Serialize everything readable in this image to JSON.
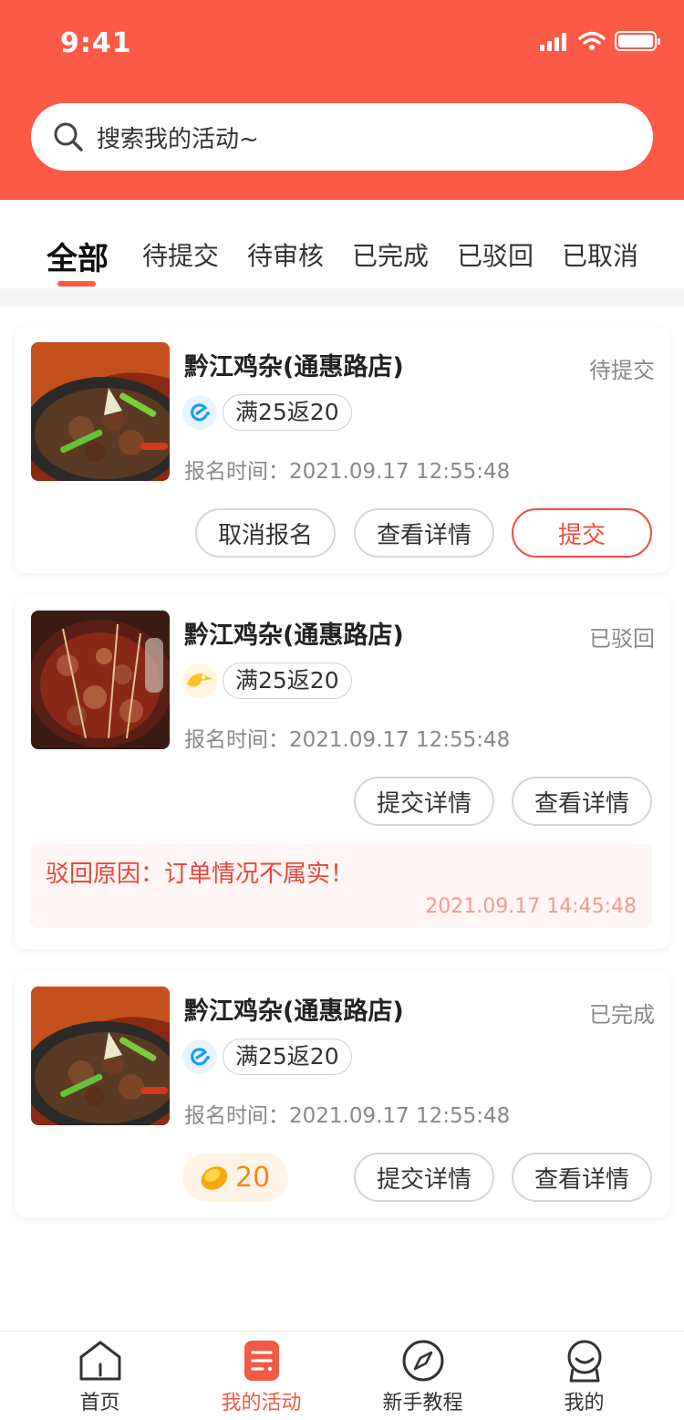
{
  "status_bar": {
    "time": "9:41"
  },
  "search": {
    "placeholder": "搜索我的活动~"
  },
  "tabs": [
    {
      "label": "全部",
      "active": true
    },
    {
      "label": "待提交",
      "active": false
    },
    {
      "label": "待审核",
      "active": false
    },
    {
      "label": "已完成",
      "active": false
    },
    {
      "label": "已驳回",
      "active": false
    },
    {
      "label": "已取消",
      "active": false
    }
  ],
  "activities": [
    {
      "store": "黔江鸡杂(通惠路店)",
      "status": "待提交",
      "platform_icon": "eleme-icon",
      "promo": "满25返20",
      "signup_time": "报名时间：2021.09.17 12:55:48",
      "buttons": [
        "取消报名",
        "查看详情",
        "提交"
      ]
    },
    {
      "store": "黔江鸡杂(通惠路店)",
      "status": "已驳回",
      "platform_icon": "meituan-icon",
      "promo": "满25返20",
      "signup_time": "报名时间：2021.09.17 12:55:48",
      "buttons": [
        "提交详情",
        "查看详情"
      ],
      "reject_reason": "驳回原因：订单情况不属实！",
      "reject_time": "2021.09.17 14:45:48"
    },
    {
      "store": "黔江鸡杂(通惠路店)",
      "status": "已完成",
      "platform_icon": "eleme-icon",
      "promo": "满25返20",
      "signup_time": "报名时间：2021.09.17 12:55:48",
      "reward": "20",
      "buttons": [
        "提交详情",
        "查看详情"
      ]
    }
  ],
  "tabbar": [
    {
      "label": "首页",
      "icon": "home-icon",
      "active": false
    },
    {
      "label": "我的活动",
      "icon": "activity-icon",
      "active": true
    },
    {
      "label": "新手教程",
      "icon": "compass-icon",
      "active": false
    },
    {
      "label": "我的",
      "icon": "profile-icon",
      "active": false
    }
  ],
  "colors": {
    "brand": "#fa5a46",
    "accent_text": "#ef4d3c",
    "reject_bg": "#fff5f4",
    "reward_text": "#f08a1a"
  }
}
